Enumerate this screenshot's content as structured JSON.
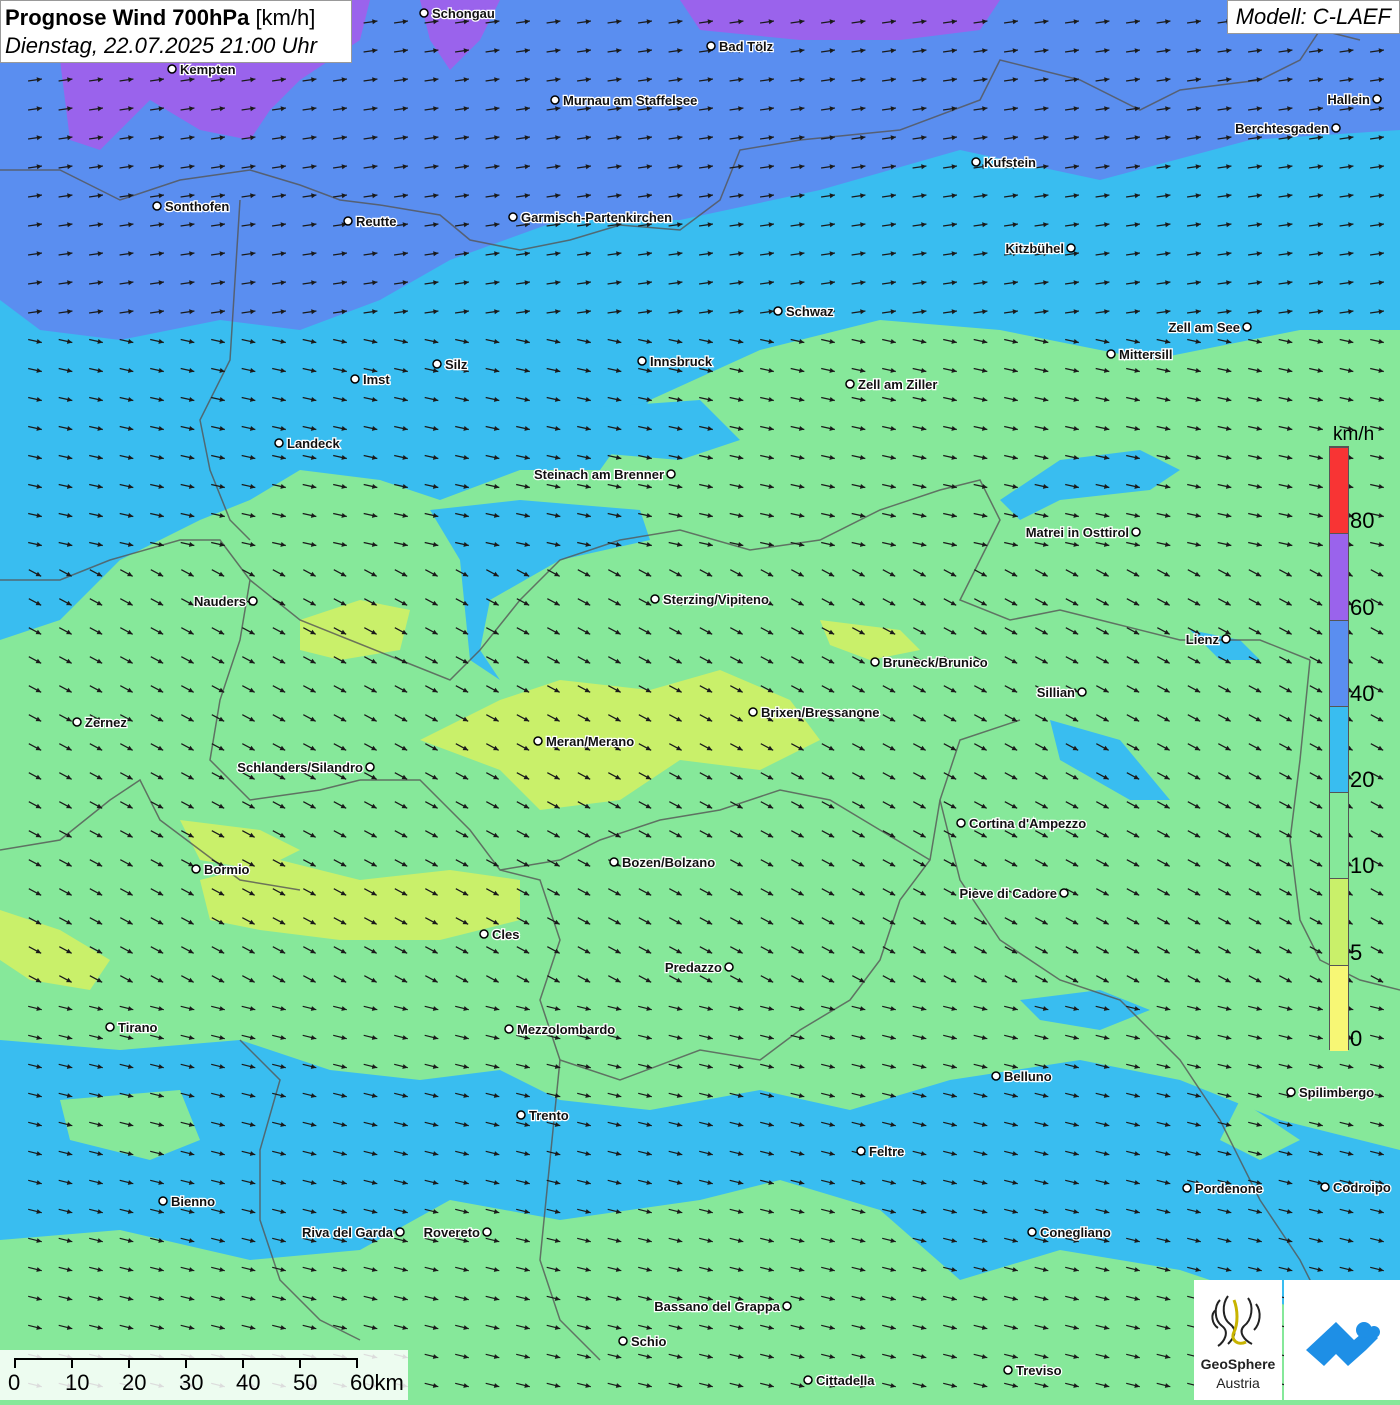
{
  "header": {
    "title": "Prognose Wind 700hPa",
    "unit": "[km/h]",
    "datetime": "Dienstag, 22.07.2025 21:00 Uhr"
  },
  "model": {
    "label": "Modell: C-LAEF"
  },
  "legend": {
    "unit": "km/h",
    "levels": [
      {
        "label": "0",
        "color": "#f7f775"
      },
      {
        "label": "5",
        "color": "#c9f06a"
      },
      {
        "label": "10",
        "color": "#86e89a"
      },
      {
        "label": "20",
        "color": "#39bdf0"
      },
      {
        "label": "40",
        "color": "#5a8ef0"
      },
      {
        "label": "60",
        "color": "#9a63ec"
      },
      {
        "label": "80",
        "color": "#f83434"
      }
    ]
  },
  "scale_bar": {
    "labels": [
      "0",
      "10",
      "20",
      "30",
      "40",
      "50",
      "60km"
    ]
  },
  "cities": [
    {
      "name": "Schongau"
    },
    {
      "name": "Bad Tölz"
    },
    {
      "name": "Kempten"
    },
    {
      "name": "Murnau am Staffelsee"
    },
    {
      "name": "Hallein"
    },
    {
      "name": "Berchtesgaden"
    },
    {
      "name": "Kufstein"
    },
    {
      "name": "Sonthofen"
    },
    {
      "name": "Reutte"
    },
    {
      "name": "Garmisch-Partenkirchen"
    },
    {
      "name": "Kitzbühel"
    },
    {
      "name": "Schwaz"
    },
    {
      "name": "Zell am See"
    },
    {
      "name": "Mittersill"
    },
    {
      "name": "Innsbruck"
    },
    {
      "name": "Silz"
    },
    {
      "name": "Imst"
    },
    {
      "name": "Zell am Ziller"
    },
    {
      "name": "Landeck"
    },
    {
      "name": "Steinach am Brenner"
    },
    {
      "name": "Matrei in Osttirol"
    },
    {
      "name": "Nauders"
    },
    {
      "name": "Sterzing/Vipiteno"
    },
    {
      "name": "Lienz"
    },
    {
      "name": "Bruneck/Brunico"
    },
    {
      "name": "Sillian"
    },
    {
      "name": "Zernez"
    },
    {
      "name": "Brixen/Bressanone"
    },
    {
      "name": "Meran/Merano"
    },
    {
      "name": "Schlanders/Silandro"
    },
    {
      "name": "Cortina d'Ampezzo"
    },
    {
      "name": "Bormio"
    },
    {
      "name": "Bozen/Bolzano"
    },
    {
      "name": "Pieve di Cadore"
    },
    {
      "name": "Cles"
    },
    {
      "name": "Predazzo"
    },
    {
      "name": "Tirano"
    },
    {
      "name": "Mezzolombardo"
    },
    {
      "name": "Belluno"
    },
    {
      "name": "Spilimbergo"
    },
    {
      "name": "Trento"
    },
    {
      "name": "Feltre"
    },
    {
      "name": "Bienno"
    },
    {
      "name": "Pordenone"
    },
    {
      "name": "Codroipo"
    },
    {
      "name": "Riva del Garda"
    },
    {
      "name": "Rovereto"
    },
    {
      "name": "Conegliano"
    },
    {
      "name": "Bassano del Grappa"
    },
    {
      "name": "Schio"
    },
    {
      "name": "Treviso"
    },
    {
      "name": "Cittadella"
    }
  ],
  "logo": {
    "line1": "GeoSphere",
    "line2": "Austria"
  }
}
